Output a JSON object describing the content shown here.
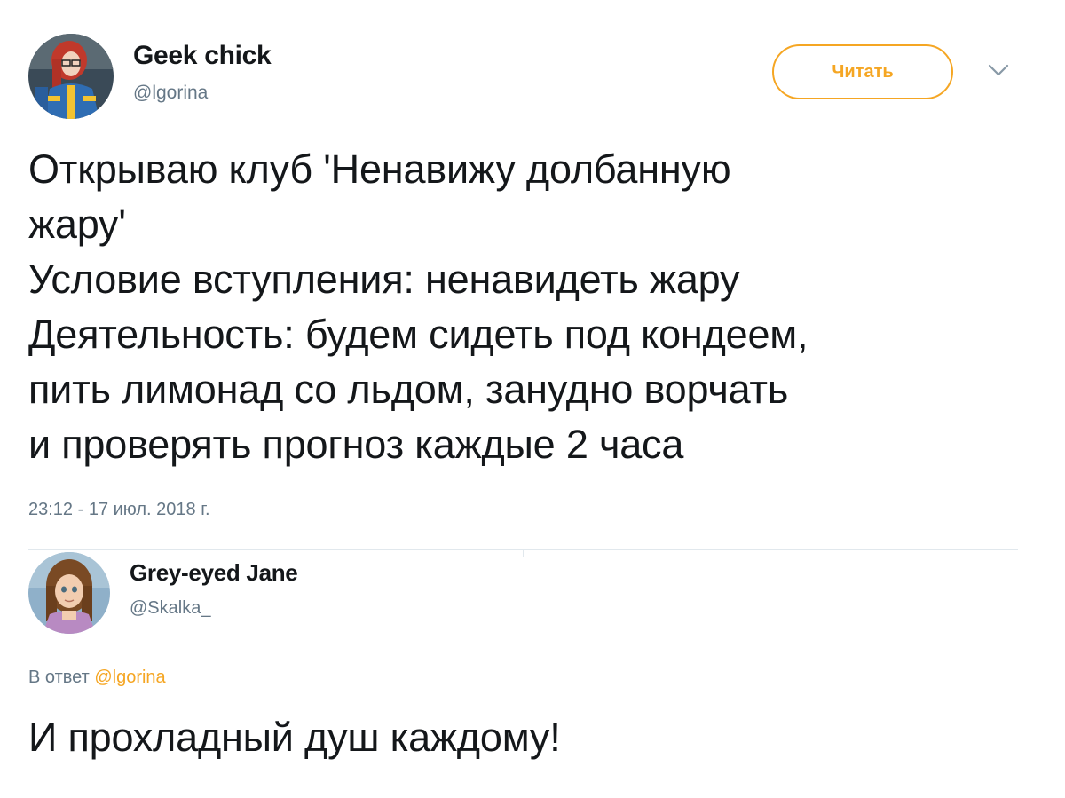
{
  "tweet": {
    "author": {
      "name": "Geek chick",
      "handle": "@lgorina",
      "avatar_icon": "avatar-red-hair-glasses-blue-outfit"
    },
    "follow_label": "Читать",
    "menu_icon": "chevron-down-icon",
    "text": "Открываю клуб 'Ненавижу долбанную\nжару'\nУсловие вступления: ненавидеть жару\nДеятельность: будем сидеть под кондеем,\nпить лимонад со льдом, занудно ворчать\nи проверять прогноз каждые 2 часа",
    "timestamp": "23:12 - 17 июл. 2018 г."
  },
  "reply": {
    "author": {
      "name": "Grey-eyed Jane",
      "handle": "@Skalka_",
      "avatar_icon": "avatar-animated-girl-brown-hair"
    },
    "context_prefix": "В ответ",
    "context_mention": "@lgorina",
    "text": "И прохладный душ каждому!"
  },
  "colors": {
    "accent": "#f5a623",
    "text_primary": "#14171a",
    "text_secondary": "#657786",
    "divider": "#e1e8ed"
  }
}
